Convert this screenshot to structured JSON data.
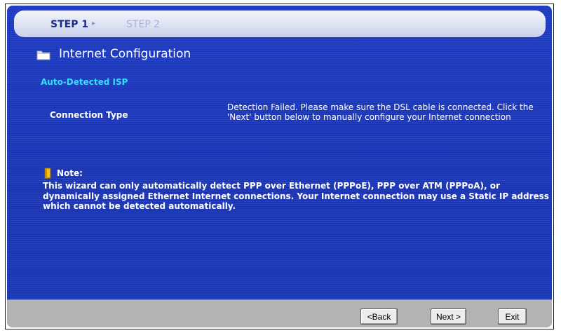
{
  "steps": {
    "step1": "STEP 1",
    "separator": "▸",
    "step2": "STEP 2"
  },
  "page": {
    "title": "Internet Configuration",
    "title_icon": "folder-icon"
  },
  "section": {
    "heading": "Auto-Detected ISP",
    "connection_type_label": "Connection Type",
    "detection_message": "Detection Failed. Please make sure the DSL cable is connected. Click the 'Next' button below to manually configure your Internet connection"
  },
  "note": {
    "icon": "note-icon",
    "label": "Note:",
    "text": "This wizard can only automatically detect PPP over Ethernet (PPPoE), PPP over ATM (PPPoA), or dynamically assigned Ethernet Internet connections. Your Internet connection may use a Static IP address which cannot be detected automatically."
  },
  "buttons": {
    "back": "<Back",
    "next": "Next >",
    "exit": "Exit"
  },
  "colors": {
    "panel": "#1b36b8",
    "section_heading": "#31e0ff",
    "footer": "#b3b3b3"
  }
}
